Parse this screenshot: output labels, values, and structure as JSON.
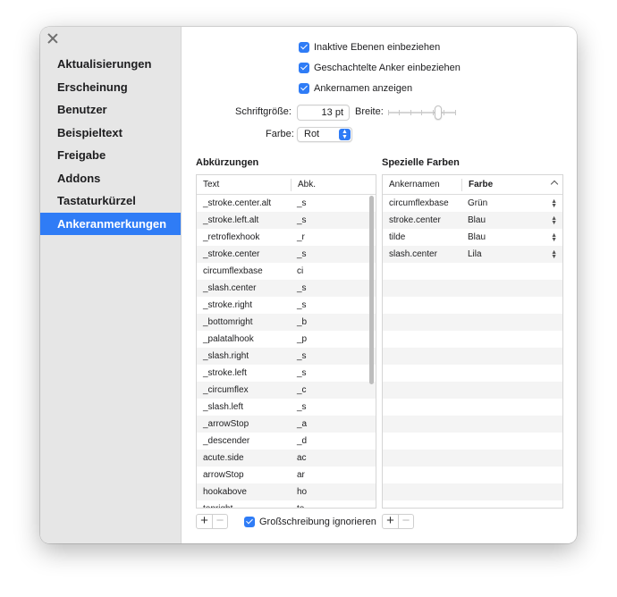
{
  "sidebar": {
    "items": [
      {
        "label": "Aktualisierungen",
        "active": false
      },
      {
        "label": "Erscheinung",
        "active": false
      },
      {
        "label": "Benutzer",
        "active": false
      },
      {
        "label": "Beispieltext",
        "active": false
      },
      {
        "label": "Freigabe",
        "active": false
      },
      {
        "label": "Addons",
        "active": false
      },
      {
        "label": "Tastaturkürzel",
        "active": false
      },
      {
        "label": "Ankeranmerkungen",
        "active": true
      }
    ]
  },
  "options": {
    "inactive_layers": {
      "label": "Inaktive Ebenen einbeziehen",
      "checked": true
    },
    "nested_anchors": {
      "label": "Geschachtelte Anker einbeziehen",
      "checked": true
    },
    "show_names": {
      "label": "Ankernamen anzeigen",
      "checked": true
    }
  },
  "font_size": {
    "label": "Schriftgröße:",
    "value": "13 pt"
  },
  "width": {
    "label": "Breite:"
  },
  "color": {
    "label": "Farbe:",
    "value": "Rot"
  },
  "abbreviations": {
    "title": "Abkürzungen",
    "columns": [
      "Text",
      "Abk."
    ],
    "rows": [
      [
        "_stroke.center.alt",
        "_s"
      ],
      [
        "_stroke.left.alt",
        "_s"
      ],
      [
        "_retroflexhook",
        "_r"
      ],
      [
        "_stroke.center",
        "_s"
      ],
      [
        "circumflexbase",
        "ci"
      ],
      [
        "_slash.center",
        "_s"
      ],
      [
        "_stroke.right",
        "_s"
      ],
      [
        "_bottomright",
        "_b"
      ],
      [
        "_palatalhook",
        "_p"
      ],
      [
        "_slash.right",
        "_s"
      ],
      [
        "_stroke.left",
        "_s"
      ],
      [
        "_circumflex",
        "_c"
      ],
      [
        "_slash.left",
        "_s"
      ],
      [
        "_arrowStop",
        "_a"
      ],
      [
        "_descender",
        "_d"
      ],
      [
        "acute.side",
        "ac"
      ],
      [
        "arrowStop",
        "ar"
      ],
      [
        "hookabove",
        "ho"
      ],
      [
        "topright",
        "to"
      ]
    ],
    "ignore_case": {
      "label": "Großschreibung ignorieren",
      "checked": true
    }
  },
  "special_colors": {
    "title": "Spezielle Farben",
    "columns": [
      "Ankernamen",
      "Farbe"
    ],
    "rows": [
      [
        "circumflexbase",
        "Grün"
      ],
      [
        "stroke.center",
        "Blau"
      ],
      [
        "tilde",
        "Blau"
      ],
      [
        "slash.center",
        "Lila"
      ]
    ]
  },
  "buttons": {
    "add": "+",
    "remove": "−"
  },
  "icons": {
    "close": "close-icon",
    "popup": "chevron-up-down-icon",
    "sort": "chevron-up-icon",
    "stepper": "stepper-icon"
  },
  "colors": {
    "accent": "#2f7cf6",
    "sidebar": "#e6e6e6"
  }
}
